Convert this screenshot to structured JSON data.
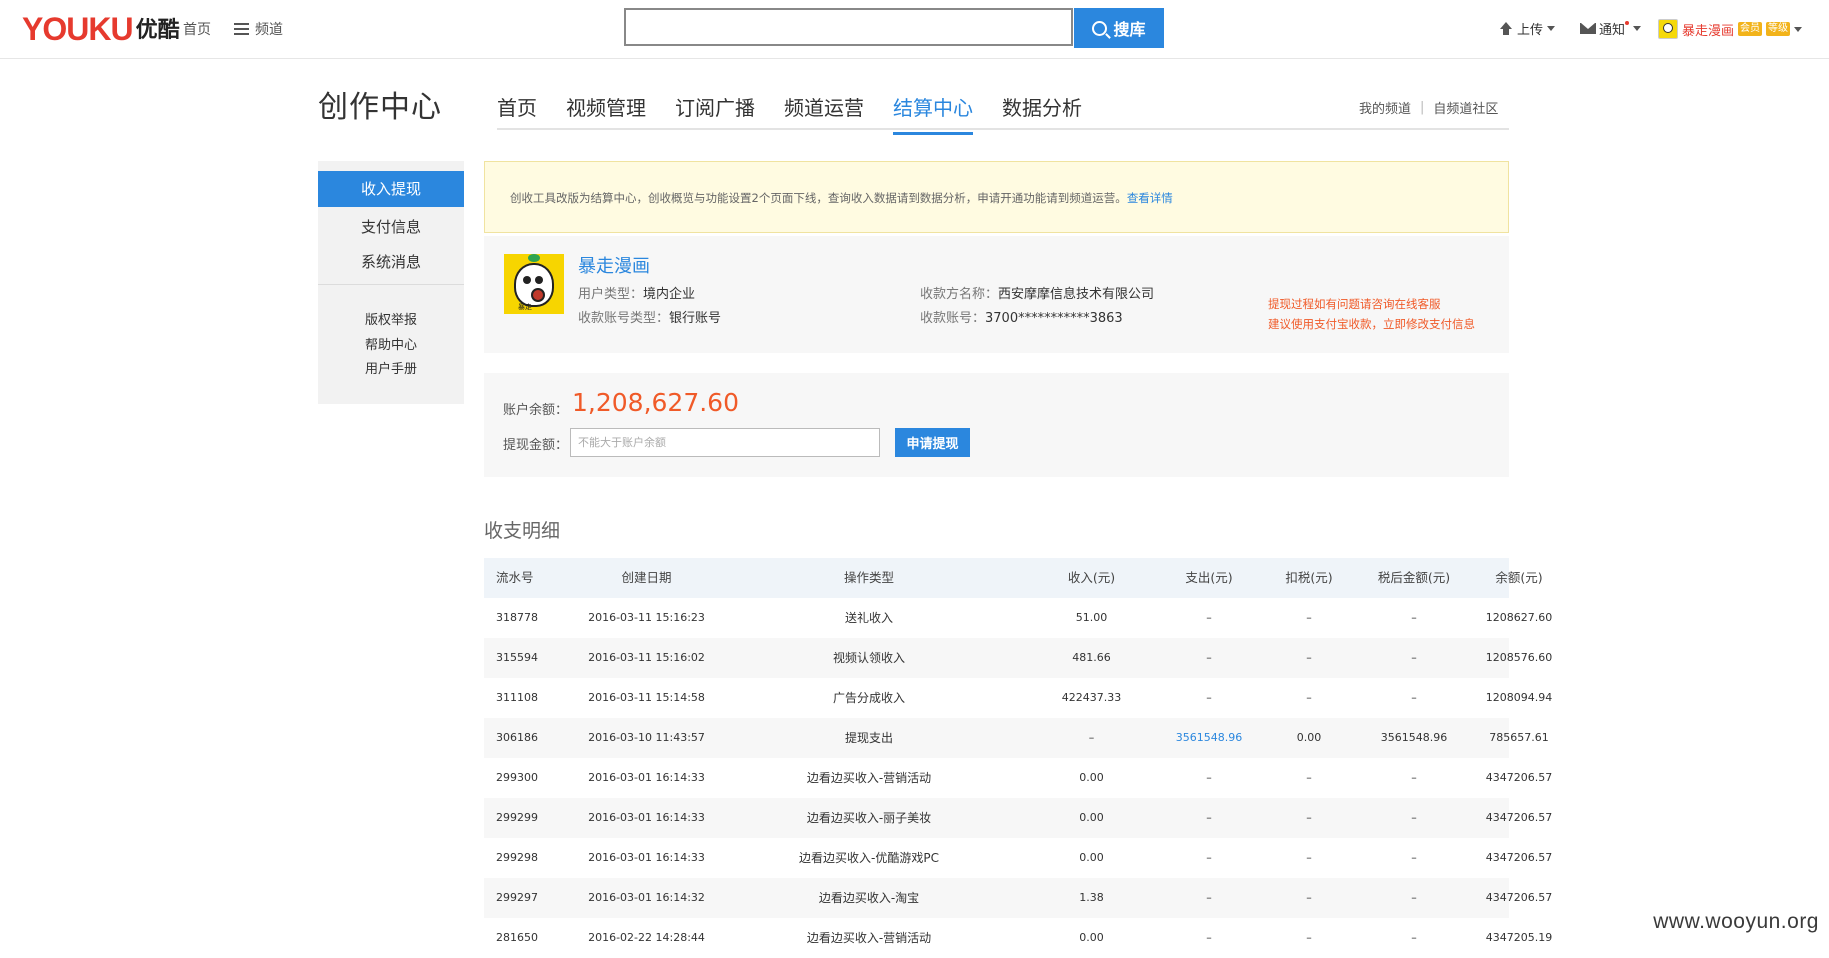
{
  "topbar": {
    "logo_text": "YOUKU",
    "logo_cn": "优酷",
    "home": "首页",
    "channel": "频道",
    "search_button": "搜库",
    "upload": "上传",
    "notice": "通知",
    "user_name": "暴走漫画",
    "badges": [
      "会员",
      "等级"
    ]
  },
  "header": {
    "title": "创作中心",
    "tabs": [
      "首页",
      "视频管理",
      "订阅广播",
      "频道运营",
      "结算中心",
      "数据分析"
    ],
    "active_tab": "结算中心",
    "links": [
      "我的频道",
      "自频道社区"
    ]
  },
  "sidebar": {
    "items": [
      "收入提现",
      "支付信息",
      "系统消息"
    ],
    "sub_items": [
      "版权举报",
      "帮助中心",
      "用户手册"
    ]
  },
  "notice": {
    "text": "创收工具改版为结算中心，创收概览与功能设置2个页面下线，查询收入数据请到数据分析，申请开通功能请到频道运营。",
    "link": "查看详情"
  },
  "profile": {
    "name": "暴走漫画",
    "user_type_label": "用户类型：",
    "user_type": "境内企业",
    "account_type_label": "收款账号类型：",
    "account_type": "银行账号",
    "payee_label": "收款方名称：",
    "payee": "西安摩摩信息技术有限公司",
    "account_no_label": "收款账号：",
    "account_no": "3700***********3863",
    "tip1": "提现过程如有问题请咨询在线客服",
    "tip2": "建议使用支付宝收款，立即修改支付信息",
    "avatar_tag": "暴走"
  },
  "balance": {
    "label": "账户余额：",
    "amount": "1,208,627.60",
    "withdraw_label": "提现金额：",
    "withdraw_placeholder": "不能大于账户余额",
    "withdraw_button": "申请提现"
  },
  "ledger": {
    "title": "收支明细",
    "columns": [
      "流水号",
      "创建日期",
      "操作类型",
      "收入(元)",
      "支出(元)",
      "扣税(元)",
      "税后金额(元)",
      "余额(元)"
    ],
    "rows": [
      [
        "318778",
        "2016-03-11 15:16:23",
        "送礼收入",
        "51.00",
        "–",
        "–",
        "–",
        "1208627.60"
      ],
      [
        "315594",
        "2016-03-11 15:16:02",
        "视频认领收入",
        "481.66",
        "–",
        "–",
        "–",
        "1208576.60"
      ],
      [
        "311108",
        "2016-03-11 15:14:58",
        "广告分成收入",
        "422437.33",
        "–",
        "–",
        "–",
        "1208094.94"
      ],
      [
        "306186",
        "2016-03-10 11:43:57",
        "提现支出",
        "–",
        "3561548.96",
        "0.00",
        "3561548.96",
        "785657.61"
      ],
      [
        "299300",
        "2016-03-01 16:14:33",
        "边看边买收入-营销活动",
        "0.00",
        "–",
        "–",
        "–",
        "4347206.57"
      ],
      [
        "299299",
        "2016-03-01 16:14:33",
        "边看边买收入-丽子美妆",
        "0.00",
        "–",
        "–",
        "–",
        "4347206.57"
      ],
      [
        "299298",
        "2016-03-01 16:14:33",
        "边看边买收入-优酷游戏PC",
        "0.00",
        "–",
        "–",
        "–",
        "4347206.57"
      ],
      [
        "299297",
        "2016-03-01 16:14:32",
        "边看边买收入-淘宝",
        "1.38",
        "–",
        "–",
        "–",
        "4347206.57"
      ],
      [
        "281650",
        "2016-02-22 14:28:44",
        "边看边买收入-营销活动",
        "0.00",
        "–",
        "–",
        "–",
        "4347205.19"
      ]
    ]
  },
  "watermark": "www.wooyun.org",
  "colors": {
    "accent": "#2b87de",
    "brand": "#e63a2e",
    "amount": "#f05a28",
    "notice_bg": "#fffbe1"
  }
}
